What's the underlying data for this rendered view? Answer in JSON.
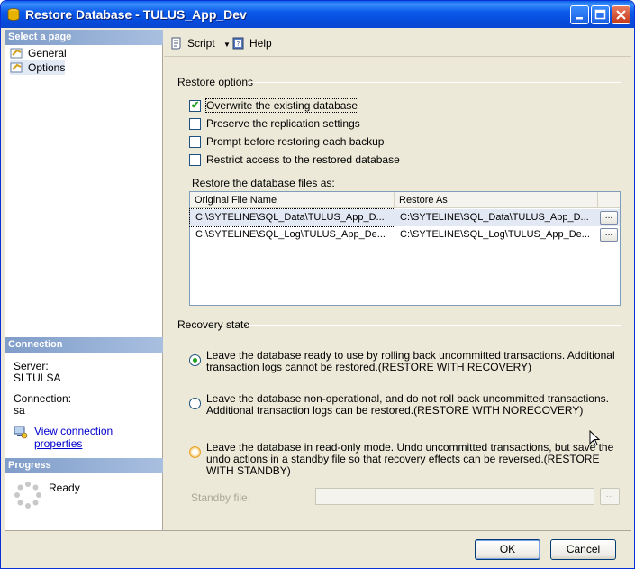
{
  "window": {
    "title": "Restore Database - TULUS_App_Dev"
  },
  "left_panel": {
    "select_page_header": "Select a page",
    "pages": [
      {
        "label": "General",
        "icon": "page-icon"
      },
      {
        "label": "Options",
        "icon": "page-icon"
      }
    ],
    "connection_header": "Connection",
    "server_label": "Server:",
    "server_value": "SLTULSA",
    "connection_label": "Connection:",
    "connection_value": "sa",
    "view_connection_link": "View connection properties",
    "progress_header": "Progress",
    "progress_status": "Ready"
  },
  "toolbar": {
    "script_label": "Script",
    "help_label": "Help"
  },
  "restore_options": {
    "title": "Restore options",
    "checkboxes": [
      {
        "label": "Overwrite the existing database",
        "checked": true
      },
      {
        "label": "Preserve the replication settings",
        "checked": false
      },
      {
        "label": "Prompt before restoring each backup",
        "checked": false
      },
      {
        "label": "Restrict access to the restored database",
        "checked": false
      }
    ],
    "files_label": "Restore the database files as:",
    "grid": {
      "columns": [
        "Original File Name",
        "Restore As"
      ],
      "rows": [
        {
          "original": "C:\\SYTELINE\\SQL_Data\\TULUS_App_D...",
          "restore_as": "C:\\SYTELINE\\SQL_Data\\TULUS_App_D...",
          "button": "..."
        },
        {
          "original": "C:\\SYTELINE\\SQL_Log\\TULUS_App_De...",
          "restore_as": "C:\\SYTELINE\\SQL_Log\\TULUS_App_De...",
          "button": "..."
        }
      ]
    }
  },
  "recovery_state": {
    "title": "Recovery state",
    "options": [
      {
        "label": "Leave the database ready to use by rolling back uncommitted transactions. Additional transaction logs cannot be restored.(RESTORE WITH RECOVERY)",
        "selected": true
      },
      {
        "label": "Leave the database non-operational, and do not roll back uncommitted transactions. Additional transaction logs can be restored.(RESTORE WITH NORECOVERY)",
        "selected": false
      },
      {
        "label": "Leave the database in read-only mode. Undo uncommitted transactions, but save the undo actions in a standby file so that recovery effects can be reversed.(RESTORE WITH STANDBY)",
        "selected": false
      }
    ],
    "standby_label": "Standby file:",
    "standby_value": "",
    "standby_button": "..."
  },
  "footer": {
    "ok_label": "OK",
    "cancel_label": "Cancel"
  },
  "colors": {
    "title_bar": "#0a5fe6",
    "section_header": "#7f9dc9",
    "window_bg": "#ece9d8"
  }
}
